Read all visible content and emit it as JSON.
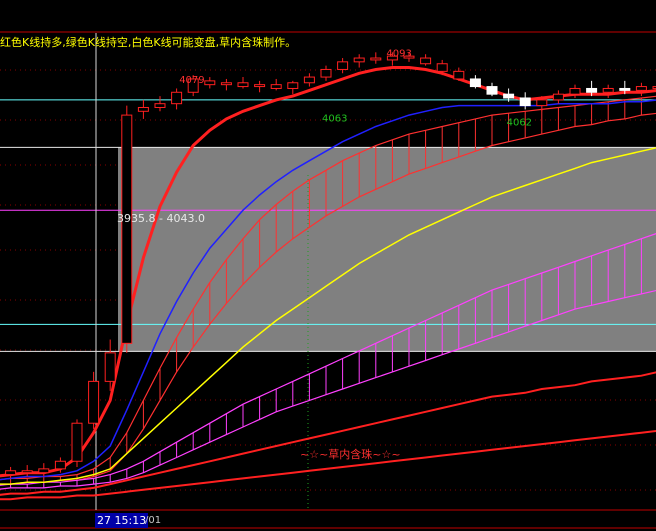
{
  "caption": "红色K线持多,绿色K线持空,白色K线可能变盘,草内含珠制作。",
  "range_label": "3935.8 - 4043.0",
  "price_labels": [
    "4079",
    "4093",
    "4063",
    "4062"
  ],
  "annotation": "~☆~草内含珠~☆~",
  "cursor_time": "27 15:13",
  "date_fragment": "/01",
  "colors": {
    "background": "#000000",
    "bull_candle": "#ff2020",
    "bear_candle": "#ffffff",
    "ma_fast": "#ff2020",
    "ma_mid": "#2020ff",
    "ma_slow": "#ffff00",
    "band_red": "#ff3030",
    "band_magenta": "#ff40ff",
    "highlight_box": "#808080"
  },
  "chart_data": {
    "type": "line",
    "description_source": "candlestick price chart with moving averages and channel bands",
    "title": "",
    "range_box": [
      3935.8,
      4043.0
    ],
    "candles": [
      {
        "o": 3872,
        "h": 3876,
        "l": 3869,
        "c": 3871,
        "dir": "up"
      },
      {
        "o": 3871,
        "h": 3875,
        "l": 3869,
        "c": 3873,
        "dir": "up"
      },
      {
        "o": 3873,
        "h": 3876,
        "l": 3870,
        "c": 3872,
        "dir": "up"
      },
      {
        "o": 3872,
        "h": 3877,
        "l": 3870,
        "c": 3874,
        "dir": "up"
      },
      {
        "o": 3874,
        "h": 3880,
        "l": 3872,
        "c": 3878,
        "dir": "up"
      },
      {
        "o": 3878,
        "h": 3900,
        "l": 3875,
        "c": 3898,
        "dir": "up"
      },
      {
        "o": 3898,
        "h": 3925,
        "l": 3895,
        "c": 3920,
        "dir": "up"
      },
      {
        "o": 3920,
        "h": 3942,
        "l": 3915,
        "c": 3935,
        "dir": "up"
      },
      {
        "o": 3940,
        "h": 4065,
        "l": 3935,
        "c": 4060,
        "dir": "up"
      },
      {
        "o": 4062,
        "h": 4068,
        "l": 4058,
        "c": 4064,
        "dir": "up"
      },
      {
        "o": 4064,
        "h": 4070,
        "l": 4062,
        "c": 4066,
        "dir": "up"
      },
      {
        "o": 4066,
        "h": 4074,
        "l": 4063,
        "c": 4072,
        "dir": "up"
      },
      {
        "o": 4072,
        "h": 4081,
        "l": 4070,
        "c": 4079,
        "dir": "up"
      },
      {
        "o": 4078,
        "h": 4080,
        "l": 4074,
        "c": 4076,
        "dir": "up"
      },
      {
        "o": 4076,
        "h": 4079,
        "l": 4073,
        "c": 4077,
        "dir": "up"
      },
      {
        "o": 4077,
        "h": 4080,
        "l": 4074,
        "c": 4075,
        "dir": "up"
      },
      {
        "o": 4075,
        "h": 4078,
        "l": 4072,
        "c": 4076,
        "dir": "up"
      },
      {
        "o": 4076,
        "h": 4079,
        "l": 4073,
        "c": 4074,
        "dir": "up"
      },
      {
        "o": 4074,
        "h": 4078,
        "l": 4071,
        "c": 4077,
        "dir": "up"
      },
      {
        "o": 4077,
        "h": 4082,
        "l": 4075,
        "c": 4080,
        "dir": "up"
      },
      {
        "o": 4080,
        "h": 4086,
        "l": 4078,
        "c": 4084,
        "dir": "up"
      },
      {
        "o": 4084,
        "h": 4090,
        "l": 4082,
        "c": 4088,
        "dir": "up"
      },
      {
        "o": 4088,
        "h": 4092,
        "l": 4085,
        "c": 4090,
        "dir": "up"
      },
      {
        "o": 4090,
        "h": 4093,
        "l": 4087,
        "c": 4089,
        "dir": "up"
      },
      {
        "o": 4089,
        "h": 4093,
        "l": 4086,
        "c": 4091,
        "dir": "up"
      },
      {
        "o": 4091,
        "h": 4093,
        "l": 4088,
        "c": 4090,
        "dir": "up"
      },
      {
        "o": 4090,
        "h": 4092,
        "l": 4086,
        "c": 4087,
        "dir": "up"
      },
      {
        "o": 4087,
        "h": 4089,
        "l": 4081,
        "c": 4083,
        "dir": "up"
      },
      {
        "o": 4083,
        "h": 4085,
        "l": 4078,
        "c": 4079,
        "dir": "up"
      },
      {
        "o": 4079,
        "h": 4081,
        "l": 4074,
        "c": 4075,
        "dir": "down"
      },
      {
        "o": 4075,
        "h": 4077,
        "l": 4070,
        "c": 4071,
        "dir": "down"
      },
      {
        "o": 4071,
        "h": 4074,
        "l": 4067,
        "c": 4069,
        "dir": "down"
      },
      {
        "o": 4069,
        "h": 4072,
        "l": 4063,
        "c": 4065,
        "dir": "down"
      },
      {
        "o": 4065,
        "h": 4070,
        "l": 4062,
        "c": 4068,
        "dir": "up"
      },
      {
        "o": 4068,
        "h": 4073,
        "l": 4066,
        "c": 4071,
        "dir": "up"
      },
      {
        "o": 4071,
        "h": 4076,
        "l": 4069,
        "c": 4074,
        "dir": "up"
      },
      {
        "o": 4074,
        "h": 4078,
        "l": 4070,
        "c": 4072,
        "dir": "down"
      },
      {
        "o": 4072,
        "h": 4076,
        "l": 4069,
        "c": 4074,
        "dir": "up"
      },
      {
        "o": 4074,
        "h": 4078,
        "l": 4071,
        "c": 4073,
        "dir": "down"
      },
      {
        "o": 4073,
        "h": 4077,
        "l": 4070,
        "c": 4075,
        "dir": "up"
      },
      {
        "o": 4075,
        "h": 4078,
        "l": 4071,
        "c": 4074,
        "dir": "up"
      }
    ],
    "series": [
      {
        "key": "ma5",
        "color": "#ff2020",
        "width": 3,
        "values": [
          3870,
          3871,
          3872,
          3872,
          3874,
          3880,
          3893,
          3910,
          3950,
          3985,
          4012,
          4030,
          4044,
          4052,
          4058,
          4062,
          4065,
          4068,
          4070,
          4073,
          4076,
          4079,
          4082,
          4084,
          4085,
          4085,
          4084,
          4082,
          4079,
          4076,
          4073,
          4070,
          4068,
          4069,
          4070,
          4071,
          4071,
          4071,
          4072,
          4072,
          4073
        ]
      },
      {
        "key": "ma10",
        "color": "#2020ff",
        "width": 1.5,
        "values": [
          3868,
          3869,
          3870,
          3870,
          3871,
          3873,
          3878,
          3886,
          3905,
          3925,
          3945,
          3962,
          3977,
          3990,
          4000,
          4010,
          4018,
          4025,
          4031,
          4036,
          4041,
          4046,
          4050,
          4054,
          4057,
          4060,
          4062,
          4064,
          4065,
          4065,
          4065,
          4065,
          4065,
          4065,
          4066,
          4066,
          4066,
          4066,
          4067,
          4067,
          4068
        ]
      },
      {
        "key": "ma20",
        "color": "#ffff00",
        "width": 1.5,
        "values": [
          3866,
          3866,
          3867,
          3867,
          3868,
          3869,
          3871,
          3874,
          3882,
          3890,
          3898,
          3906,
          3914,
          3922,
          3930,
          3938,
          3945,
          3952,
          3958,
          3964,
          3970,
          3976,
          3982,
          3987,
          3992,
          3997,
          4001,
          4005,
          4009,
          4013,
          4017,
          4020,
          4023,
          4026,
          4029,
          4032,
          4035,
          4037,
          4039,
          4041,
          4043
        ]
      }
    ],
    "bands": [
      {
        "key": "red_channel",
        "color": "#ff3030",
        "upper": [
          3868,
          3869,
          3869,
          3870,
          3870,
          3871,
          3874,
          3880,
          3893,
          3910,
          3927,
          3943,
          3958,
          3972,
          3984,
          3995,
          4005,
          4013,
          4020,
          4026,
          4031,
          4036,
          4040,
          4044,
          4047,
          4050,
          4052,
          4054,
          4056,
          4058,
          4060,
          4061,
          4062,
          4063,
          4064,
          4065,
          4066,
          4067,
          4068,
          4069,
          4070
        ],
        "lower": [
          3866,
          3866,
          3867,
          3867,
          3868,
          3868,
          3870,
          3873,
          3882,
          3895,
          3910,
          3925,
          3938,
          3950,
          3961,
          3971,
          3980,
          3988,
          3995,
          4001,
          4007,
          4012,
          4017,
          4021,
          4025,
          4029,
          4032,
          4035,
          4038,
          4041,
          4044,
          4046,
          4048,
          4050,
          4052,
          4054,
          4055,
          4057,
          4058,
          4060,
          4061
        ]
      },
      {
        "key": "magenta_channel",
        "color": "#ff40ff",
        "upper": [
          3865,
          3866,
          3866,
          3867,
          3867,
          3868,
          3869,
          3871,
          3874,
          3878,
          3883,
          3888,
          3893,
          3898,
          3903,
          3908,
          3912,
          3916,
          3920,
          3924,
          3928,
          3932,
          3936,
          3940,
          3944,
          3948,
          3952,
          3956,
          3960,
          3964,
          3968,
          3971,
          3974,
          3977,
          3980,
          3983,
          3986,
          3989,
          3992,
          3995,
          3998
        ],
        "lower": [
          3863,
          3864,
          3864,
          3864,
          3865,
          3865,
          3866,
          3867,
          3869,
          3872,
          3876,
          3880,
          3884,
          3888,
          3892,
          3896,
          3900,
          3904,
          3907,
          3910,
          3913,
          3916,
          3919,
          3922,
          3925,
          3928,
          3931,
          3934,
          3937,
          3940,
          3943,
          3946,
          3949,
          3952,
          3955,
          3958,
          3960,
          3962,
          3964,
          3966,
          3968
        ]
      }
    ],
    "bottom_lines": [
      {
        "color": "#ff2020",
        "values": [
          3860,
          3861,
          3861,
          3862,
          3862,
          3863,
          3864,
          3866,
          3868,
          3870,
          3872,
          3874,
          3876,
          3878,
          3880,
          3882,
          3884,
          3886,
          3888,
          3890,
          3892,
          3894,
          3896,
          3898,
          3900,
          3902,
          3904,
          3906,
          3908,
          3910,
          3912,
          3913,
          3914,
          3916,
          3917,
          3918,
          3920,
          3921,
          3922,
          3923,
          3925
        ]
      },
      {
        "color": "#ff2020",
        "values": [
          3858,
          3858,
          3859,
          3859,
          3859,
          3860,
          3860,
          3861,
          3862,
          3863,
          3864,
          3865,
          3866,
          3867,
          3868,
          3869,
          3870,
          3871,
          3872,
          3873,
          3874,
          3875,
          3876,
          3877,
          3878,
          3879,
          3880,
          3881,
          3882,
          3883,
          3884,
          3885,
          3886,
          3887,
          3888,
          3889,
          3890,
          3891,
          3892,
          3893,
          3894
        ]
      }
    ],
    "hlines": [
      {
        "value": 4068,
        "color": "#66ffff"
      },
      {
        "value": 4043.0,
        "color": "#e8e8e8"
      },
      {
        "value": 4010,
        "color": "#ff40ff"
      },
      {
        "value": 3950,
        "color": "#66ffff"
      },
      {
        "value": 3935.8,
        "color": "#e8e8e8"
      }
    ],
    "y_range": [
      3855,
      4110
    ]
  }
}
